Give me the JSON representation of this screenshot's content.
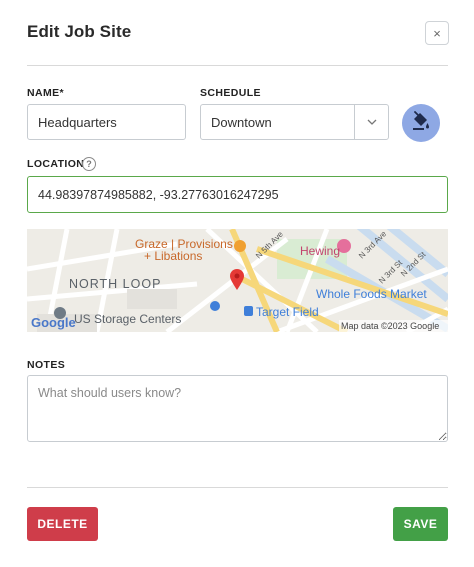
{
  "modal": {
    "title": "Edit Job Site",
    "close_label": "×"
  },
  "form": {
    "name_label": "NAME*",
    "name_value": "Headquarters",
    "schedule_label": "SCHEDULE",
    "schedule_value": "Downtown",
    "location_label": "LOCATION",
    "location_value": "44.98397874985882, -93.27763016247295",
    "notes_label": "NOTES",
    "notes_placeholder": "What should users know?"
  },
  "map": {
    "labels": {
      "graze": "Graze | Provisions",
      "libations": "+ Libations",
      "hewing": "Hewing",
      "north_loop": "NORTH LOOP",
      "whole_foods": "Whole Foods Market",
      "storage": "US Storage Centers",
      "target_field": "Target Field",
      "n3rd_ave": "N 3rd Ave",
      "n5th_ave": "N 5th Ave",
      "n2nd_st": "N 2nd St",
      "n3rd_st": "N 3rd St",
      "google": "Google",
      "attribution": "Map data ©2023 Google"
    }
  },
  "actions": {
    "delete_label": "DELETE",
    "save_label": "SAVE"
  },
  "colors": {
    "save": "#43a047",
    "delete": "#cf3d4a",
    "paint_button": "#8ea8e4",
    "location_border": "#5aa84a"
  }
}
